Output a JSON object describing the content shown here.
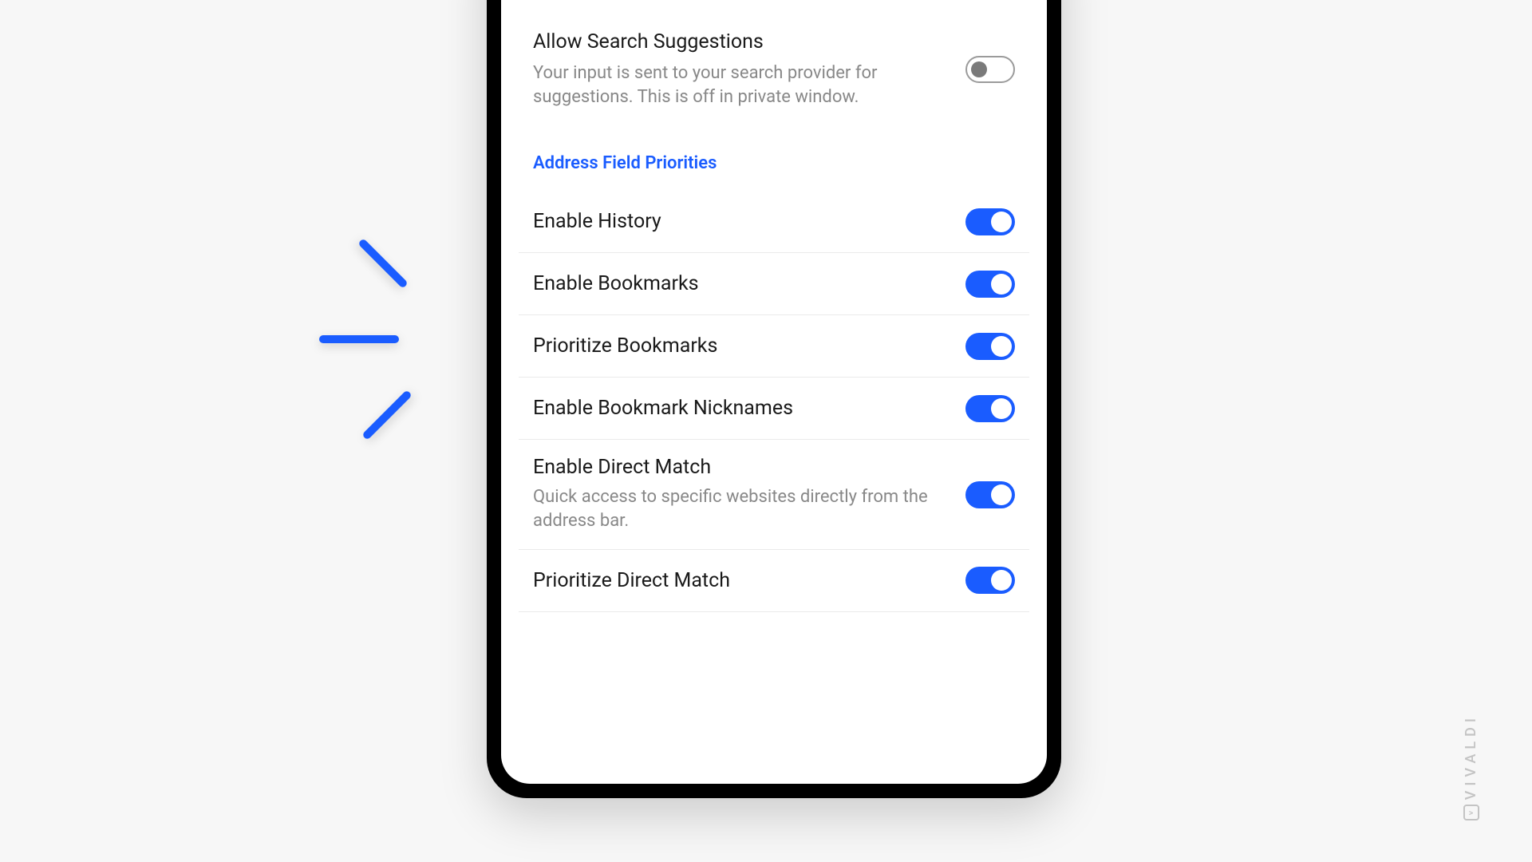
{
  "watermark": "VIVALDI",
  "watermark_icon": ">",
  "settings": {
    "suggestions": {
      "title": "Allow Search Suggestions",
      "desc": "Your input is sent to your search provider for suggestions. This is off in private window.",
      "on": false
    },
    "section_header": "Address Field Priorities",
    "items": [
      {
        "title": "Enable History",
        "desc": "",
        "on": true
      },
      {
        "title": "Enable Bookmarks",
        "desc": "",
        "on": true
      },
      {
        "title": "Prioritize Bookmarks",
        "desc": "",
        "on": true
      },
      {
        "title": "Enable Bookmark Nicknames",
        "desc": "",
        "on": true
      },
      {
        "title": "Enable Direct Match",
        "desc": "Quick access to specific websites directly from the address bar.",
        "on": true
      },
      {
        "title": "Prioritize Direct Match",
        "desc": "",
        "on": true
      }
    ]
  }
}
